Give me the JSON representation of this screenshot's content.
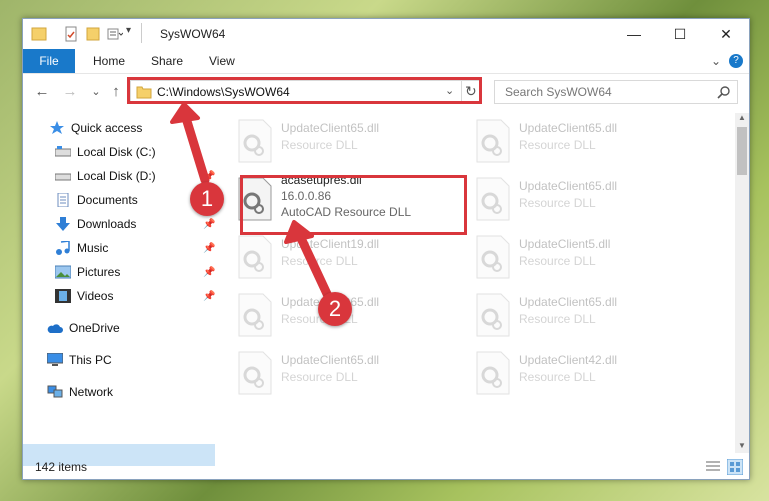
{
  "window": {
    "title": "SysWOW64",
    "minimize": "—",
    "maximize": "☐",
    "close": "✕"
  },
  "ribbon": {
    "file": "File",
    "home": "Home",
    "share": "Share",
    "view": "View",
    "expand": "⌄",
    "help": "?"
  },
  "nav": {
    "back": "←",
    "forward": "→",
    "recent": "⌄",
    "up": "↑",
    "refresh": "↻",
    "dropdown": "⌄"
  },
  "address": {
    "path": "C:\\Windows\\SysWOW64"
  },
  "search": {
    "placeholder": "Search SysWOW64"
  },
  "sidebar": {
    "items": [
      {
        "label": "Quick access"
      },
      {
        "label": "Local Disk (C:)"
      },
      {
        "label": "Local Disk (D:)"
      },
      {
        "label": "Documents"
      },
      {
        "label": "Downloads"
      },
      {
        "label": "Music"
      },
      {
        "label": "Pictures"
      },
      {
        "label": "Videos"
      },
      {
        "label": "OneDrive"
      },
      {
        "label": "This PC"
      },
      {
        "label": "Network"
      }
    ]
  },
  "files": [
    {
      "name": "UpdateClient65.dll",
      "type": "Resource DLL"
    },
    {
      "name": "UpdateClient65.dll",
      "type": "Resource DLL"
    },
    {
      "name": "acasetupres.dll",
      "version": "16.0.0.86",
      "type": "AutoCAD Resource DLL"
    },
    {
      "name": "UpdateClient65.dll",
      "type": "Resource DLL"
    },
    {
      "name": "UpdateClient19.dll",
      "type": "Resource DLL"
    },
    {
      "name": "UpdateClient5.dll",
      "type": "Resource DLL"
    },
    {
      "name": "UpdateClient65.dll",
      "type": "Resource DLL"
    },
    {
      "name": "UpdateClient65.dll",
      "type": "Resource DLL"
    },
    {
      "name": "UpdateClient65.dll",
      "type": "Resource DLL"
    },
    {
      "name": "UpdateClient42.dll",
      "type": "Resource DLL"
    }
  ],
  "status": {
    "count": "142 items"
  },
  "annotations": {
    "step1": "1",
    "step2": "2",
    "color": "#d9363c"
  }
}
